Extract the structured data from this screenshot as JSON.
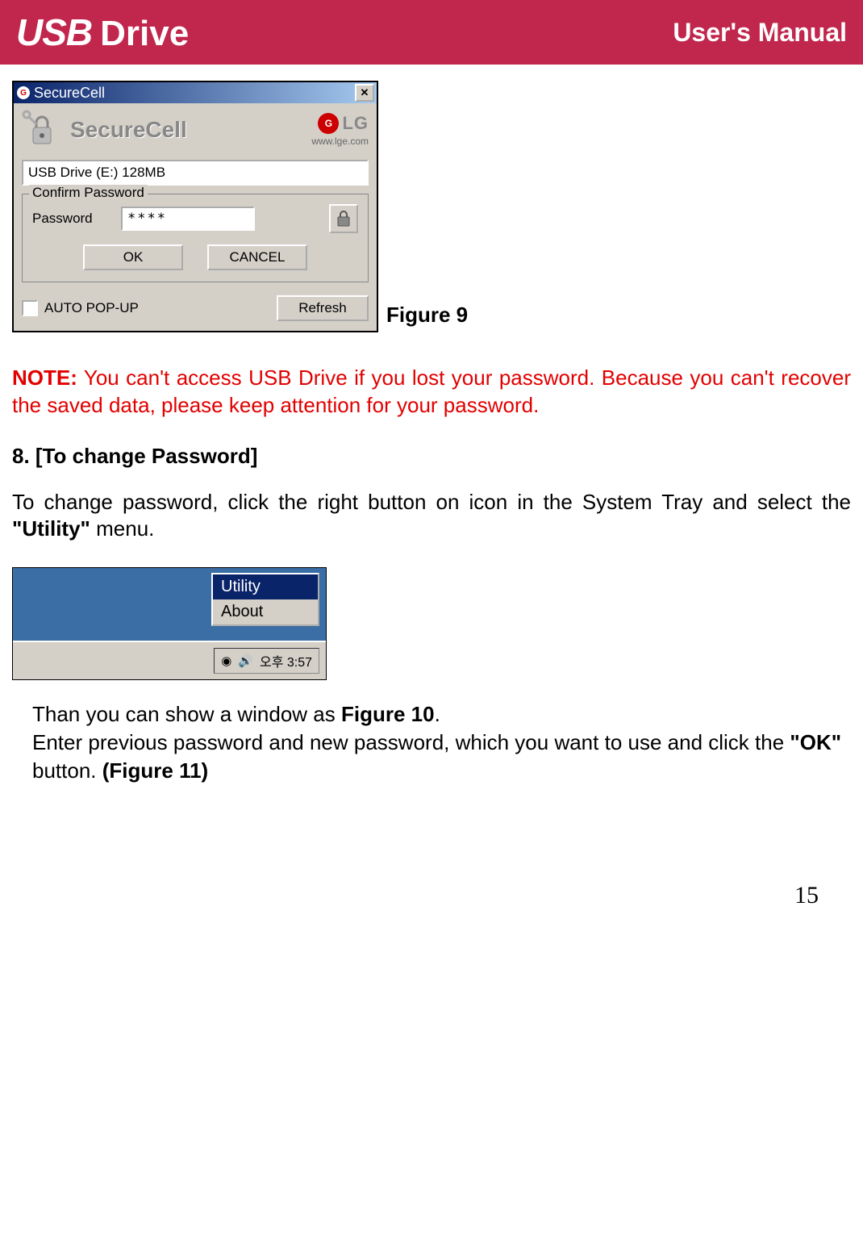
{
  "header": {
    "logo_usb": "USB",
    "logo_drive": "Drive",
    "manual_title": "User's Manual"
  },
  "dialog": {
    "title": "SecureCell",
    "brand_text": "SecureCell",
    "lg_text": "LG",
    "lg_url": "www.lge.com",
    "drive_info": "USB Drive  (E:) 128MB",
    "fieldset_legend": "Confirm Password",
    "password_label": "Password",
    "password_value": "****",
    "ok_label": "OK",
    "cancel_label": "CANCEL",
    "auto_popup_label": "AUTO POP-UP",
    "refresh_label": "Refresh"
  },
  "figure9_label": "Figure 9",
  "note": {
    "label": "NOTE:",
    "text": " You can't access USB Drive if you lost your password. Because you can't recover the saved data, please keep attention for your password."
  },
  "section8": {
    "num": "8",
    "title": ". [To change Password]"
  },
  "para1": {
    "pre": "To change password, click the right button on icon in the System Tray and select the ",
    "bold": "\"Utility\"",
    "post": " menu."
  },
  "context_menu": {
    "item1": "Utility",
    "item2": "About"
  },
  "tray_time": "오후 3:57",
  "para2": {
    "line1_pre": "Than you can show a window as ",
    "line1_bold": "Figure 10",
    "line1_post": ".",
    "line2_pre": "Enter previous password and new password, which you want to use and click the ",
    "line2_bold1": "\"OK\"",
    "line2_mid": " button. ",
    "line2_bold2": "(Figure 11)"
  },
  "page_number": "15"
}
